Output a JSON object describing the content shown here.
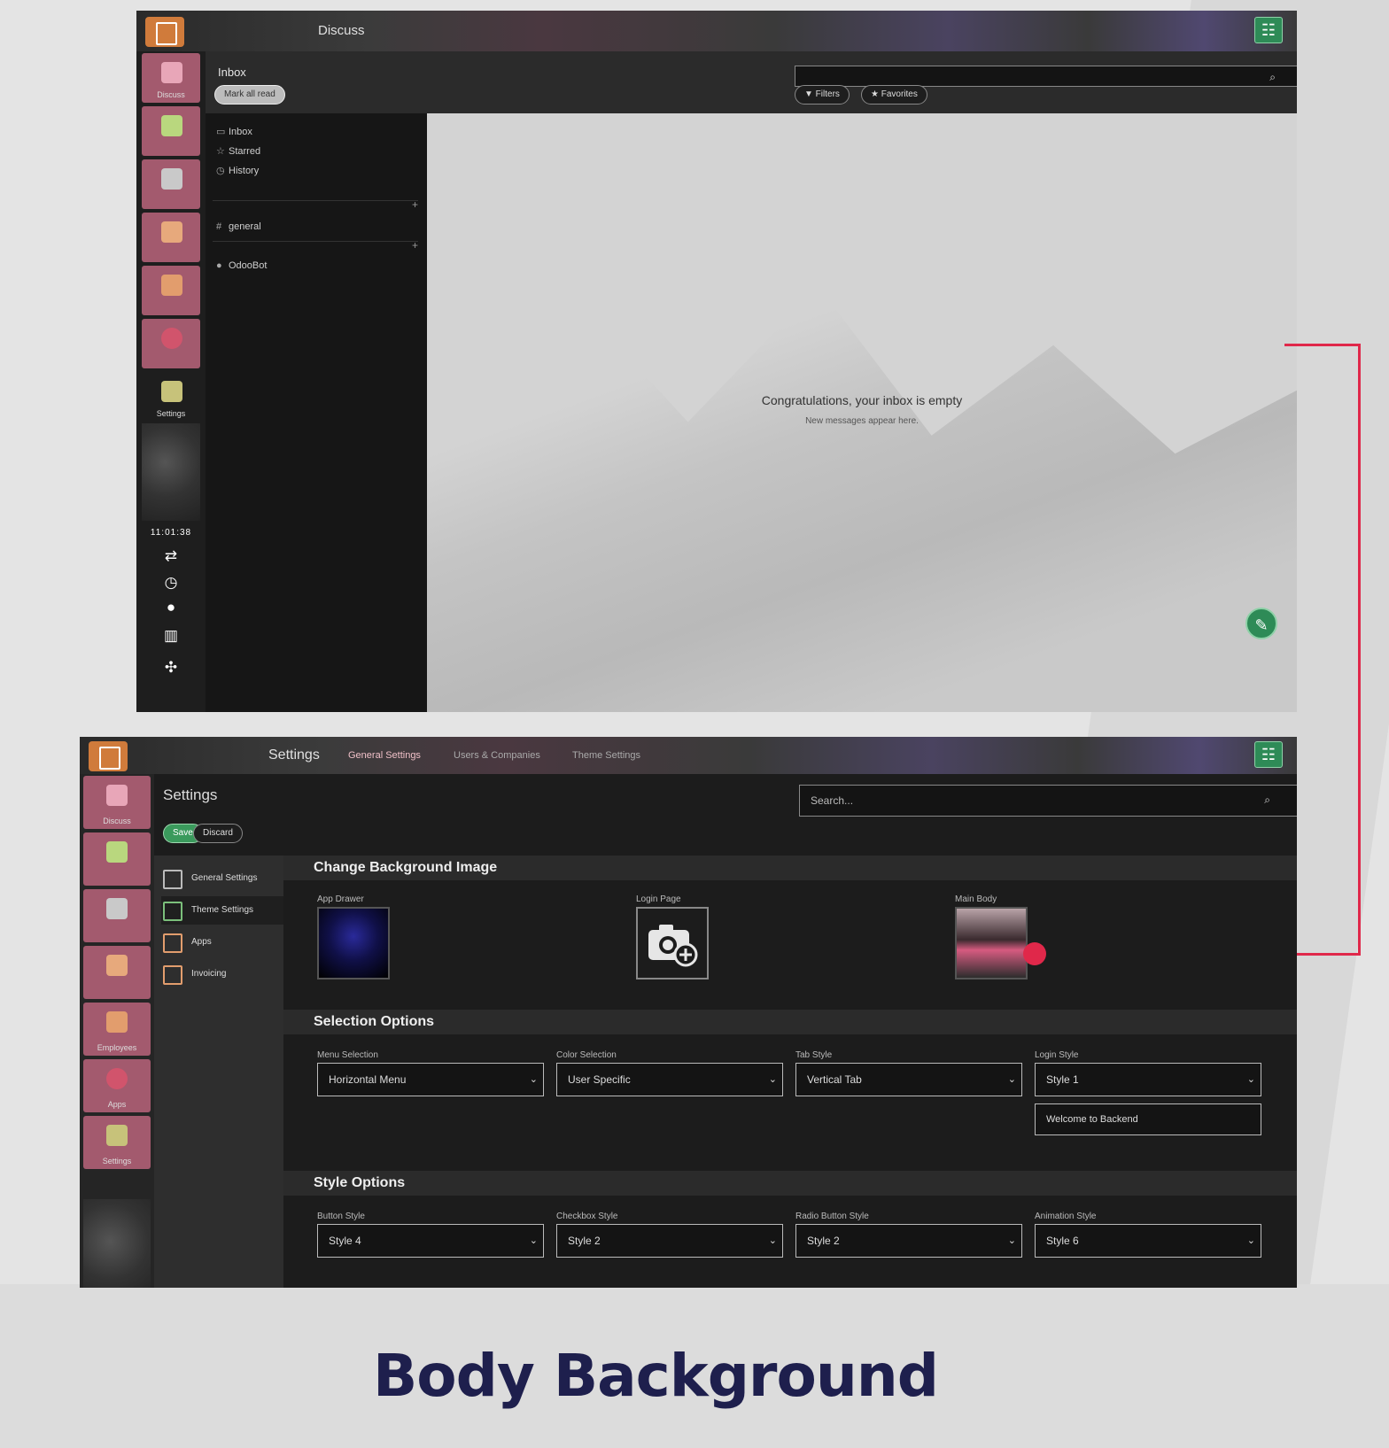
{
  "window1": {
    "app_title": "Discuss",
    "sidebar": {
      "items": [
        {
          "label": "Discuss"
        },
        {
          "label": ""
        },
        {
          "label": ""
        },
        {
          "label": ""
        },
        {
          "label": ""
        },
        {
          "label": ""
        },
        {
          "label": "Settings"
        }
      ],
      "clock": "11:01:38"
    },
    "header": {
      "title": "Inbox",
      "mark_all_read": "Mark all read",
      "search_placeholder": "",
      "filters": "▼ Filters",
      "favorites": "★ Favorites"
    },
    "nav": {
      "inbox": "Inbox",
      "starred": "Starred",
      "history": "History",
      "channels_heading": "",
      "channel_general": "general",
      "dm_heading": "",
      "dm_odoobot": "OdooBot"
    },
    "empty_state": {
      "title": "Congratulations, your inbox is empty",
      "subtitle": "New messages appear here."
    }
  },
  "window2": {
    "app_title": "Settings",
    "tabs": [
      "General Settings",
      "Users & Companies",
      "Theme Settings"
    ],
    "page_title": "Settings",
    "save_label": "Save",
    "discard_label": "Discard",
    "search_placeholder": "Search...",
    "sidebar_items": [
      {
        "label": "Discuss"
      },
      {
        "label": ""
      },
      {
        "label": ""
      },
      {
        "label": ""
      },
      {
        "label": "Employees"
      },
      {
        "label": "Apps"
      },
      {
        "label": "Settings"
      }
    ],
    "settings_menu": [
      {
        "label": "General Settings"
      },
      {
        "label": "Theme Settings"
      },
      {
        "label": "Apps"
      },
      {
        "label": "Invoicing"
      }
    ],
    "change_bg": {
      "heading": "Change Background Image",
      "app_drawer": "App Drawer",
      "login_page": "Login Page",
      "main_body": "Main Body"
    },
    "selection_options": {
      "heading": "Selection Options",
      "menu_label": "Menu Selection",
      "menu_value": "Horizontal Menu",
      "color_label": "Color Selection",
      "color_value": "User Specific",
      "tab_label": "Tab Style",
      "tab_value": "Vertical Tab",
      "login_label": "Login Style",
      "login_value": "Style 1",
      "welcome_text": "Welcome to Backend"
    },
    "style_options": {
      "heading": "Style Options",
      "button_label": "Button Style",
      "button_value": "Style 4",
      "checkbox_label": "Checkbox Style",
      "checkbox_value": "Style 2",
      "radio_label": "Radio Button Style",
      "radio_value": "Style 2",
      "animation_label": "Animation Style",
      "animation_value": "Style 6"
    }
  },
  "caption": "Body Background",
  "colors": {
    "accent_pink": "#a35a6e",
    "connector_red": "#e0284a",
    "green": "#2e8b57",
    "caption_navy": "#1e1f4d"
  }
}
